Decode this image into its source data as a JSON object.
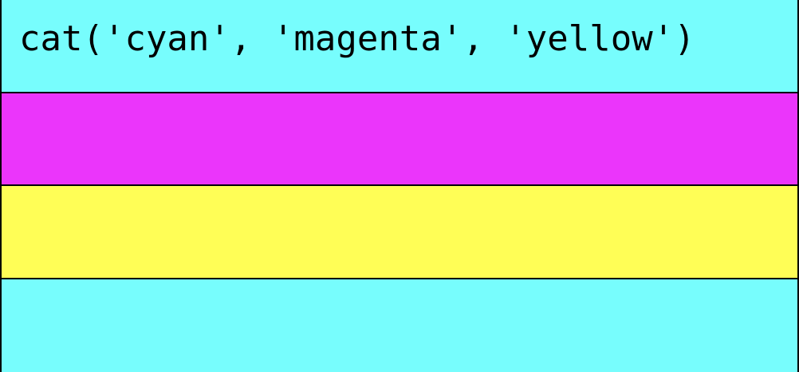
{
  "code_line": "cat('cyan', 'magenta', 'yellow')",
  "bands": [
    {
      "name": "cyan",
      "color": "#77fdfd"
    },
    {
      "name": "magenta",
      "color": "#eb35fb"
    },
    {
      "name": "yellow",
      "color": "#fffe56"
    },
    {
      "name": "cyan",
      "color": "#77fdfd"
    }
  ]
}
